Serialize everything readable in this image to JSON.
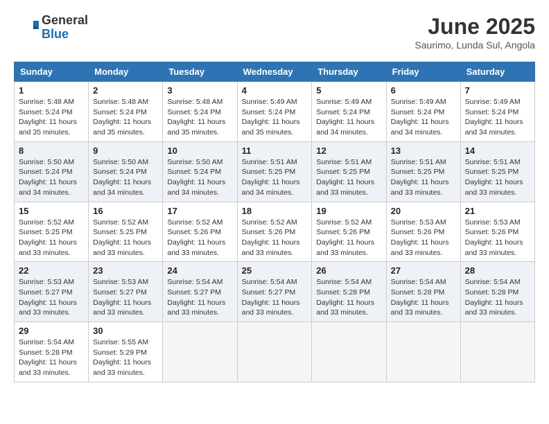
{
  "header": {
    "logo_general": "General",
    "logo_blue": "Blue",
    "month_title": "June 2025",
    "location": "Saurimo, Lunda Sul, Angola"
  },
  "days_of_week": [
    "Sunday",
    "Monday",
    "Tuesday",
    "Wednesday",
    "Thursday",
    "Friday",
    "Saturday"
  ],
  "weeks": [
    {
      "days": [
        {
          "num": "1",
          "sunrise": "5:48 AM",
          "sunset": "5:24 PM",
          "daylight": "11 hours and 35 minutes."
        },
        {
          "num": "2",
          "sunrise": "5:48 AM",
          "sunset": "5:24 PM",
          "daylight": "11 hours and 35 minutes."
        },
        {
          "num": "3",
          "sunrise": "5:48 AM",
          "sunset": "5:24 PM",
          "daylight": "11 hours and 35 minutes."
        },
        {
          "num": "4",
          "sunrise": "5:49 AM",
          "sunset": "5:24 PM",
          "daylight": "11 hours and 35 minutes."
        },
        {
          "num": "5",
          "sunrise": "5:49 AM",
          "sunset": "5:24 PM",
          "daylight": "11 hours and 34 minutes."
        },
        {
          "num": "6",
          "sunrise": "5:49 AM",
          "sunset": "5:24 PM",
          "daylight": "11 hours and 34 minutes."
        },
        {
          "num": "7",
          "sunrise": "5:49 AM",
          "sunset": "5:24 PM",
          "daylight": "11 hours and 34 minutes."
        }
      ]
    },
    {
      "days": [
        {
          "num": "8",
          "sunrise": "5:50 AM",
          "sunset": "5:24 PM",
          "daylight": "11 hours and 34 minutes."
        },
        {
          "num": "9",
          "sunrise": "5:50 AM",
          "sunset": "5:24 PM",
          "daylight": "11 hours and 34 minutes."
        },
        {
          "num": "10",
          "sunrise": "5:50 AM",
          "sunset": "5:24 PM",
          "daylight": "11 hours and 34 minutes."
        },
        {
          "num": "11",
          "sunrise": "5:51 AM",
          "sunset": "5:25 PM",
          "daylight": "11 hours and 34 minutes."
        },
        {
          "num": "12",
          "sunrise": "5:51 AM",
          "sunset": "5:25 PM",
          "daylight": "11 hours and 33 minutes."
        },
        {
          "num": "13",
          "sunrise": "5:51 AM",
          "sunset": "5:25 PM",
          "daylight": "11 hours and 33 minutes."
        },
        {
          "num": "14",
          "sunrise": "5:51 AM",
          "sunset": "5:25 PM",
          "daylight": "11 hours and 33 minutes."
        }
      ]
    },
    {
      "days": [
        {
          "num": "15",
          "sunrise": "5:52 AM",
          "sunset": "5:25 PM",
          "daylight": "11 hours and 33 minutes."
        },
        {
          "num": "16",
          "sunrise": "5:52 AM",
          "sunset": "5:25 PM",
          "daylight": "11 hours and 33 minutes."
        },
        {
          "num": "17",
          "sunrise": "5:52 AM",
          "sunset": "5:26 PM",
          "daylight": "11 hours and 33 minutes."
        },
        {
          "num": "18",
          "sunrise": "5:52 AM",
          "sunset": "5:26 PM",
          "daylight": "11 hours and 33 minutes."
        },
        {
          "num": "19",
          "sunrise": "5:52 AM",
          "sunset": "5:26 PM",
          "daylight": "11 hours and 33 minutes."
        },
        {
          "num": "20",
          "sunrise": "5:53 AM",
          "sunset": "5:26 PM",
          "daylight": "11 hours and 33 minutes."
        },
        {
          "num": "21",
          "sunrise": "5:53 AM",
          "sunset": "5:26 PM",
          "daylight": "11 hours and 33 minutes."
        }
      ]
    },
    {
      "days": [
        {
          "num": "22",
          "sunrise": "5:53 AM",
          "sunset": "5:27 PM",
          "daylight": "11 hours and 33 minutes."
        },
        {
          "num": "23",
          "sunrise": "5:53 AM",
          "sunset": "5:27 PM",
          "daylight": "11 hours and 33 minutes."
        },
        {
          "num": "24",
          "sunrise": "5:54 AM",
          "sunset": "5:27 PM",
          "daylight": "11 hours and 33 minutes."
        },
        {
          "num": "25",
          "sunrise": "5:54 AM",
          "sunset": "5:27 PM",
          "daylight": "11 hours and 33 minutes."
        },
        {
          "num": "26",
          "sunrise": "5:54 AM",
          "sunset": "5:28 PM",
          "daylight": "11 hours and 33 minutes."
        },
        {
          "num": "27",
          "sunrise": "5:54 AM",
          "sunset": "5:28 PM",
          "daylight": "11 hours and 33 minutes."
        },
        {
          "num": "28",
          "sunrise": "5:54 AM",
          "sunset": "5:28 PM",
          "daylight": "11 hours and 33 minutes."
        }
      ]
    },
    {
      "days": [
        {
          "num": "29",
          "sunrise": "5:54 AM",
          "sunset": "5:28 PM",
          "daylight": "11 hours and 33 minutes."
        },
        {
          "num": "30",
          "sunrise": "5:55 AM",
          "sunset": "5:29 PM",
          "daylight": "11 hours and 33 minutes."
        },
        null,
        null,
        null,
        null,
        null
      ]
    }
  ]
}
